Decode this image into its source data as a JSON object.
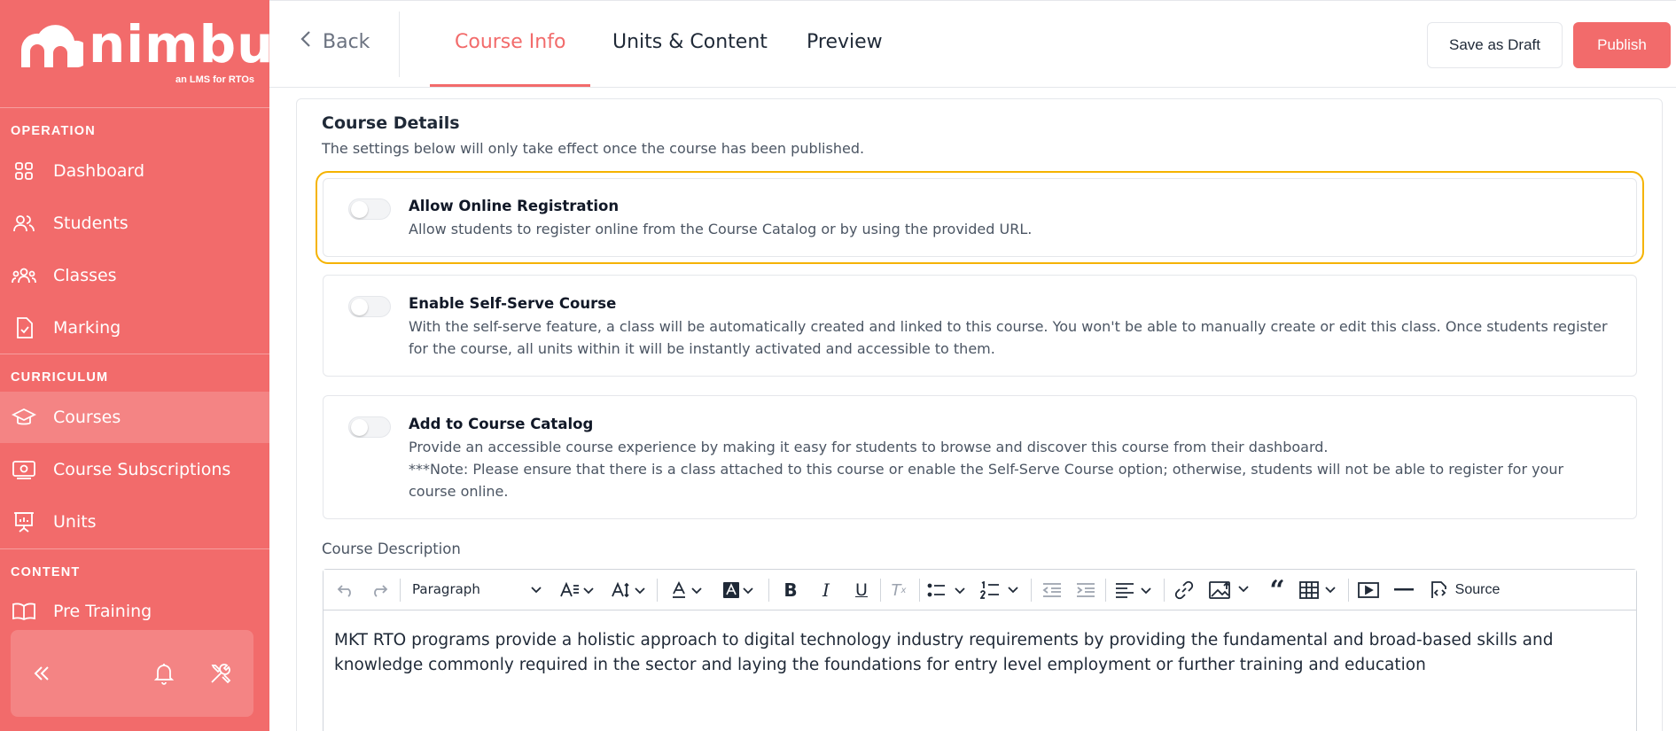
{
  "brand": {
    "name": "nimbu",
    "tagline": "an LMS for RTOs"
  },
  "sidebar": {
    "sections": [
      {
        "title": "OPERATION"
      },
      {
        "title": "CURRICULUM"
      },
      {
        "title": "CONTENT"
      }
    ],
    "items": [
      {
        "label": "Dashboard",
        "icon": "grid-icon"
      },
      {
        "label": "Students",
        "icon": "users-icon"
      },
      {
        "label": "Classes",
        "icon": "group-icon"
      },
      {
        "label": "Marking",
        "icon": "clipboard-check-icon"
      },
      {
        "label": "Courses",
        "icon": "graduation-cap-icon",
        "active": true
      },
      {
        "label": "Course Subscriptions",
        "icon": "subscription-card-icon"
      },
      {
        "label": "Units",
        "icon": "presentation-board-icon"
      },
      {
        "label": "Pre Training",
        "icon": "book-open-icon"
      }
    ],
    "utility": {
      "collapse_icon": "double-chevron-left-icon",
      "bell_icon": "bell-icon",
      "tools_icon": "tools-icon"
    }
  },
  "topbar": {
    "back_label": "Back",
    "tabs": [
      {
        "label": "Course Info",
        "active": true
      },
      {
        "label": "Units & Content"
      },
      {
        "label": "Preview"
      }
    ],
    "save_draft_label": "Save as Draft",
    "publish_label": "Publish"
  },
  "main": {
    "title": "Course Details",
    "subtitle": "The settings below will only take effect once the course has been published.",
    "options": [
      {
        "title": "Allow Online Registration",
        "description": "Allow students to register online from the Course Catalog or by using the provided URL.",
        "enabled": false
      },
      {
        "title": "Enable Self-Serve Course",
        "description": "With the self-serve feature, a class will be automatically created and linked to this course. You won't be able to manually create or edit this class. Once students register for the course, all units within it will be instantly activated and accessible to them.",
        "enabled": false
      },
      {
        "title": "Add to Course Catalog",
        "description": "Provide an accessible course experience by making it easy for students to browse and discover this course from their dashboard.",
        "note": "***Note: Please ensure that there is a class attached to this course or enable the Self-Serve Course option; otherwise, students will not be able to register for your course online.",
        "enabled": false
      }
    ],
    "description_label": "Course Description",
    "editor": {
      "paragraph_style": "Paragraph",
      "source_label": "Source",
      "content": "MKT RTO programs provide a holistic approach to digital technology industry requirements by providing the fundamental and broad-based skills and knowledge commonly required in the sector and laying the foundations for entry level employment or further training and education"
    }
  },
  "colors": {
    "brand": "#f26b6b",
    "highlight": "#f5b301"
  }
}
